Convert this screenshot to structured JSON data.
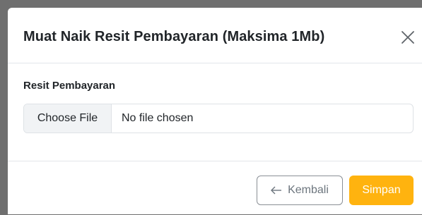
{
  "modal": {
    "title": "Muat Naik Resit Pembayaran (Maksima 1Mb)",
    "close_icon": "close-icon"
  },
  "form": {
    "field_label": "Resit Pembayaran",
    "choose_file_label": "Choose File",
    "file_status": "No file chosen"
  },
  "footer": {
    "back_label": "Kembali",
    "back_icon": "arrow-left-icon",
    "save_label": "Simpan"
  },
  "colors": {
    "backdrop": "#6f6f6f",
    "save_button": "#ffb30f",
    "back_border": "#8a8f95"
  }
}
